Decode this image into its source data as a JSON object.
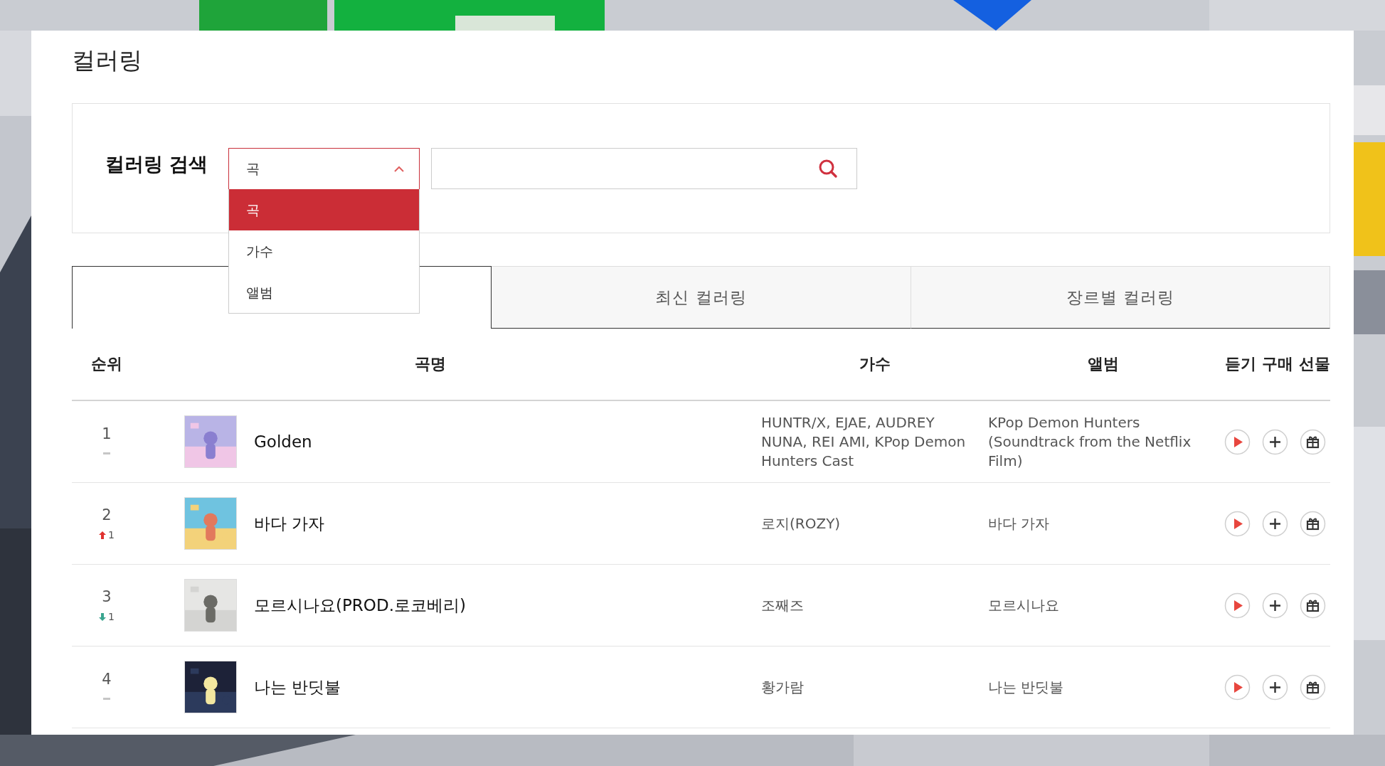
{
  "page_title": "컬러링",
  "search": {
    "label": "컬러링 검색",
    "select": {
      "value": "곡",
      "open": true,
      "options": [
        {
          "label": "곡",
          "selected": true
        },
        {
          "label": "가수",
          "selected": false
        },
        {
          "label": "앨범",
          "selected": false
        }
      ]
    }
  },
  "tabs": [
    {
      "selected": true
    },
    {
      "label": "최신 컬러링",
      "selected": false
    },
    {
      "label": "장르별 컬러링",
      "selected": false
    }
  ],
  "table": {
    "columns": [
      "순위",
      "곡명",
      "가수",
      "앨범"
    ],
    "action_columns": [
      "듣기",
      "구매",
      "선물"
    ],
    "rows": [
      {
        "rank": "1",
        "change": {
          "kind": "same"
        },
        "title": "Golden",
        "artist": "HUNTR/X, EJAE, AUDREY NUNA, REI AMI, KPop Demon Hunters Cast",
        "album": "KPop Demon Hunters (Soundtrack from the Netflix Film)"
      },
      {
        "rank": "2",
        "change": {
          "kind": "up",
          "amount": "1"
        },
        "title": "바다 가자",
        "artist": "로지(ROZY)",
        "album": "바다 가자"
      },
      {
        "rank": "3",
        "change": {
          "kind": "down",
          "amount": "1"
        },
        "title": "모르시나요(PROD.로코베리)",
        "artist": "조째즈",
        "album": "모르시나요"
      },
      {
        "rank": "4",
        "change": {
          "kind": "same"
        },
        "title": "나는 반딧불",
        "artist": "황가람",
        "album": "나는 반딧불"
      }
    ]
  }
}
